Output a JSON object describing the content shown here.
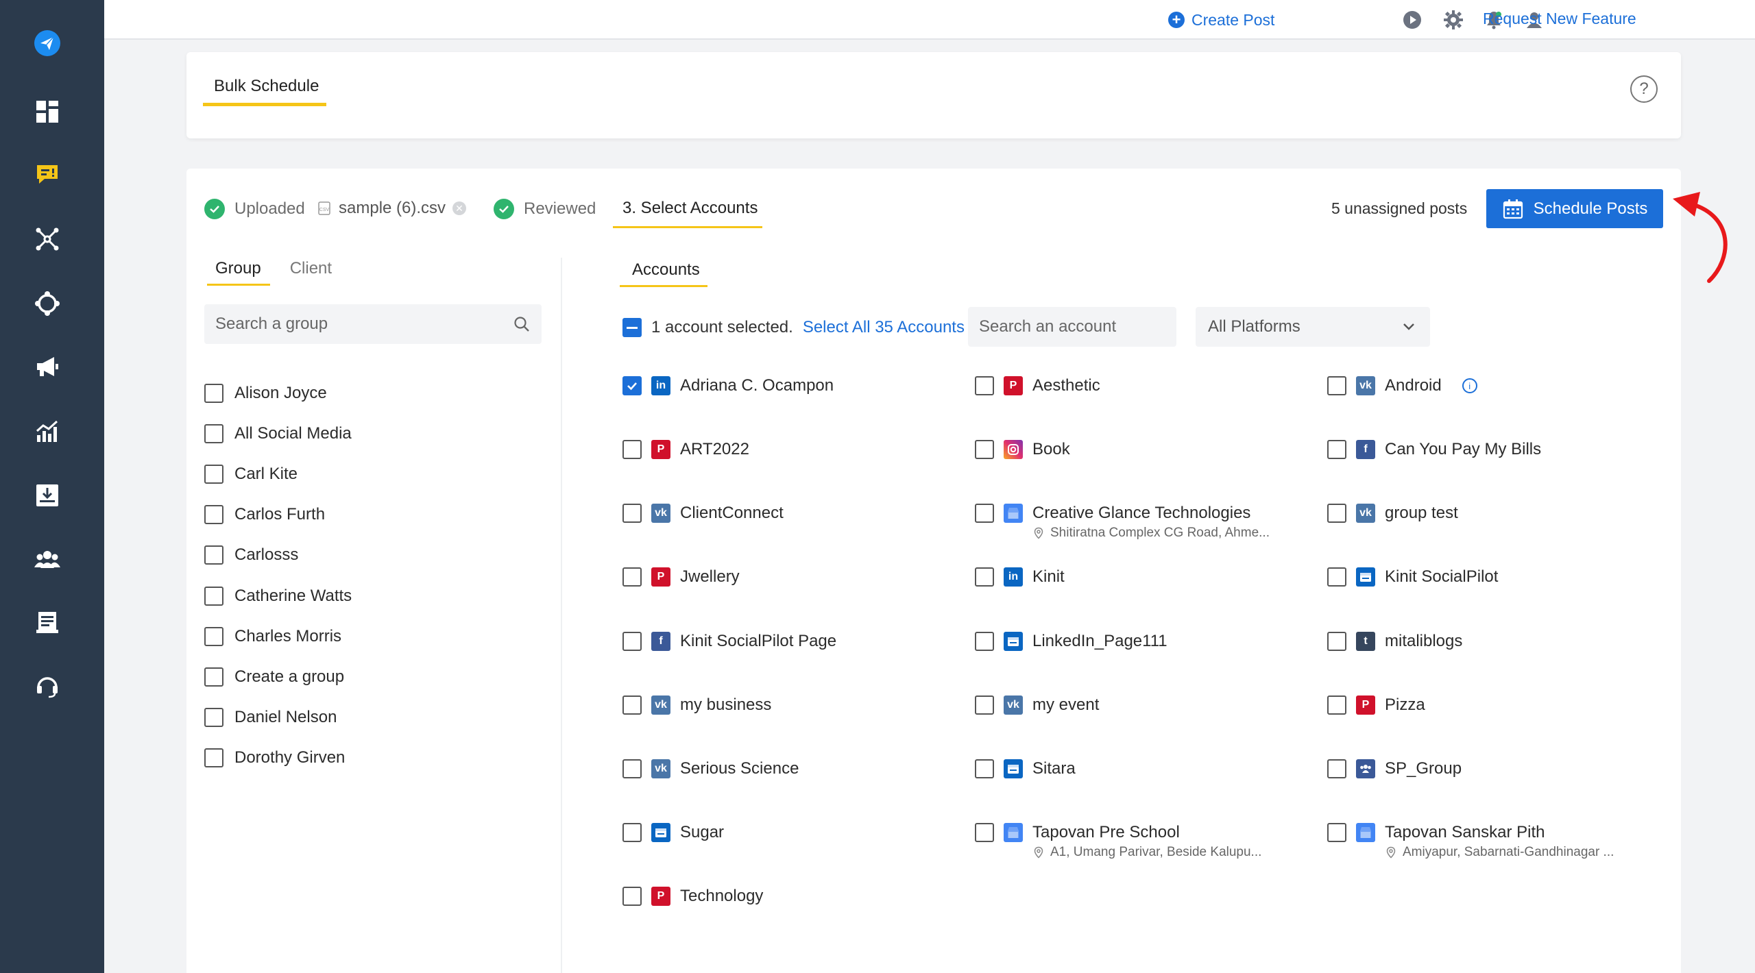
{
  "topbar": {
    "create_post": "Create Post",
    "request_feature": "Request New Feature"
  },
  "header": {
    "tab": "Bulk Schedule",
    "help_symbol": "?"
  },
  "steps": {
    "uploaded": "Uploaded",
    "file_name": "sample (6).csv",
    "reviewed": "Reviewed",
    "select_accounts": "3. Select Accounts"
  },
  "unassigned": "5 unassigned posts",
  "schedule_button": "Schedule Posts",
  "left": {
    "tabs": [
      "Group",
      "Client"
    ],
    "search_placeholder": "Search a group",
    "groups": [
      "Alison Joyce",
      "All Social Media",
      "Carl Kite",
      "Carlos Furth",
      "Carlosss",
      "Catherine Watts",
      "Charles Morris",
      "Create a group",
      "Daniel Nelson",
      "Dorothy Girven"
    ]
  },
  "right": {
    "tab": "Accounts",
    "selected_text": "1 account selected.",
    "select_all": "Select All 35 Accounts",
    "search_placeholder": "Search an account",
    "platform_filter": "All Platforms",
    "accounts": [
      {
        "name": "Adriana C. Ocampon",
        "platform": "linkedin",
        "checked": true
      },
      {
        "name": "Aesthetic",
        "platform": "pinterest"
      },
      {
        "name": "Android",
        "platform": "vk",
        "info": "i"
      },
      {
        "name": "ART2022",
        "platform": "pinterest"
      },
      {
        "name": "Book",
        "platform": "instagram"
      },
      {
        "name": "Can You Pay My Bills",
        "platform": "facebook"
      },
      {
        "name": "ClientConnect",
        "platform": "vk"
      },
      {
        "name": "Creative Glance Technologies",
        "platform": "google-business",
        "sub": "Shitiratna Complex CG Road, Ahme..."
      },
      {
        "name": "group test",
        "platform": "vk"
      },
      {
        "name": "Jwellery",
        "platform": "pinterest"
      },
      {
        "name": "Kinit",
        "platform": "linkedin"
      },
      {
        "name": "Kinit SocialPilot",
        "platform": "linkedin-page"
      },
      {
        "name": "Kinit SocialPilot Page",
        "platform": "facebook"
      },
      {
        "name": "LinkedIn_Page111",
        "platform": "linkedin-page"
      },
      {
        "name": "mitaliblogs",
        "platform": "tumblr"
      },
      {
        "name": "my business",
        "platform": "vk"
      },
      {
        "name": "my event",
        "platform": "vk"
      },
      {
        "name": "Pizza",
        "platform": "pinterest"
      },
      {
        "name": "Serious Science",
        "platform": "vk"
      },
      {
        "name": "Sitara",
        "platform": "linkedin-page"
      },
      {
        "name": "SP_Group",
        "platform": "facebook-group"
      },
      {
        "name": "Sugar",
        "platform": "linkedin-page"
      },
      {
        "name": "Tapovan Pre School",
        "platform": "google-business",
        "sub": "A1, Umang Parivar, Beside Kalupu..."
      },
      {
        "name": "Tapovan Sanskar Pith",
        "platform": "google-business",
        "sub": "Amiyapur, Sabarnati-Gandhinagar ..."
      },
      {
        "name": "Technology",
        "platform": "pinterest"
      }
    ]
  },
  "colors": {
    "sidebar": "#2b3a4c",
    "accent_blue": "#1c6fd8",
    "tab_underline": "#f5c518",
    "success_green": "#2fb46e",
    "arrow_red": "#e8191b"
  }
}
